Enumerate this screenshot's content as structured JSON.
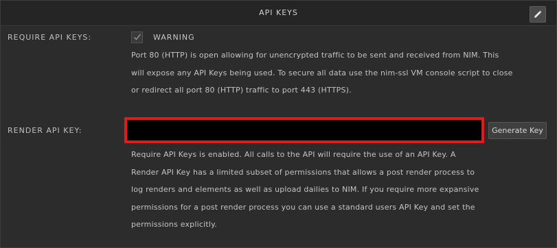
{
  "header": {
    "title": "API KEYS",
    "edit_icon": "pencil-icon"
  },
  "require_keys": {
    "label": "REQUIRE API KEYS:",
    "checked": true,
    "warning_title": "WARNING",
    "warning_lines": [
      "Port 80 (HTTP) is open allowing for unencrypted traffic to be sent and received from NIM. This",
      "will expose any API Keys being used. To secure all data use the nim-ssl VM console script to close",
      "or redirect all port 80 (HTTP) traffic to port 443 (HTTPS)."
    ]
  },
  "render_key": {
    "label": "RENDER API KEY:",
    "value": "",
    "generate_label": "Generate Key",
    "highlight_color": "#e31a1c",
    "description_lines": [
      "Require API Keys is enabled. All calls to the API will require the use of an API Key. A",
      "Render API Key has a limited subset of permissions that allows a post render process to",
      "log renders and elements as well as upload dailies to NIM. If you require more expansive",
      "permissions for a post render process you can use a standard users API Key and set the",
      "permissions explicitly."
    ]
  }
}
